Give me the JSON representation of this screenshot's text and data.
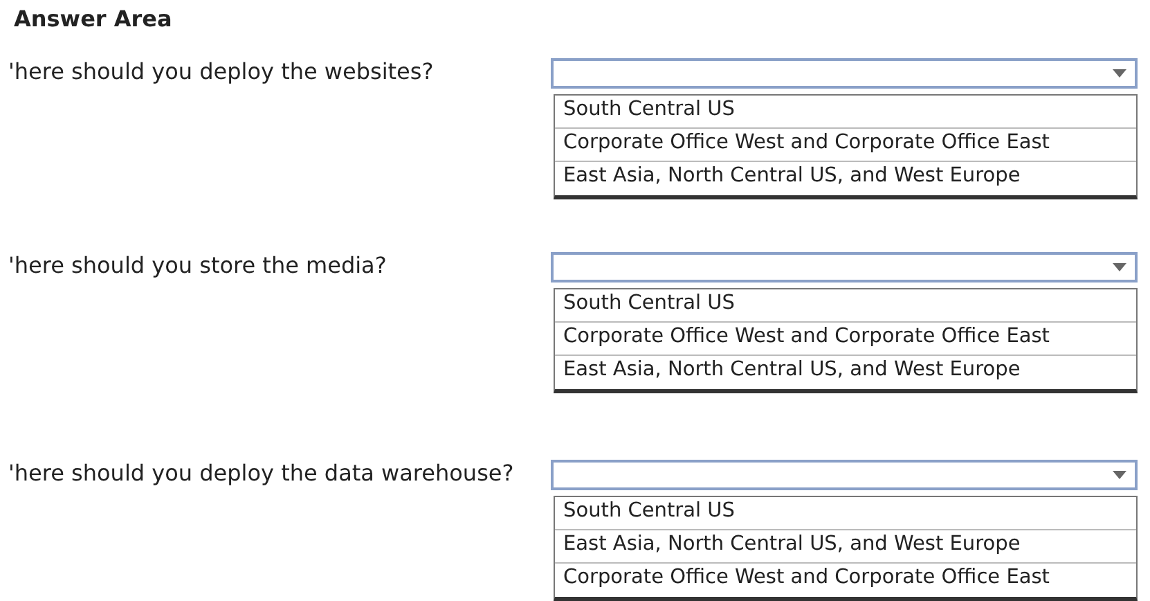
{
  "title": "Answer Area",
  "questions": [
    {
      "text": "'here should you deploy the websites?",
      "options": [
        "South Central US",
        "Corporate Office West and Corporate Office East",
        "East Asia, North Central US, and West Europe"
      ]
    },
    {
      "text": "'here should you store the media?",
      "options": [
        "South Central US",
        "Corporate Office West and Corporate Office East",
        "East Asia, North Central US, and West Europe"
      ]
    },
    {
      "text": "'here should you deploy the data warehouse?",
      "options": [
        "South Central US",
        "East Asia, North Central US, and West Europe",
        "Corporate Office West and Corporate Office East"
      ]
    }
  ]
}
